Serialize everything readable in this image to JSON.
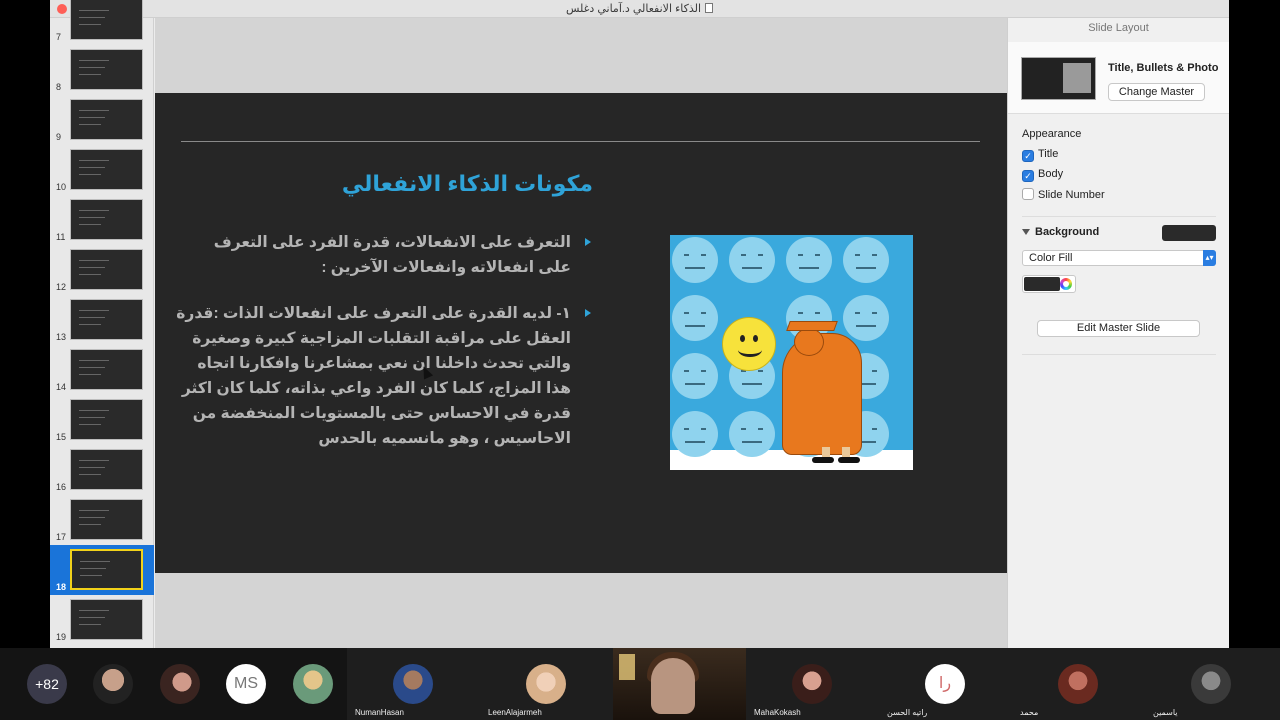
{
  "window": {
    "title": "الذكاء الانفعالي د.آماني دغلس"
  },
  "navigator": {
    "slides": [
      {
        "num": "7"
      },
      {
        "num": "8"
      },
      {
        "num": "9"
      },
      {
        "num": "10"
      },
      {
        "num": "11"
      },
      {
        "num": "12"
      },
      {
        "num": "13"
      },
      {
        "num": "14"
      },
      {
        "num": "15"
      },
      {
        "num": "16"
      },
      {
        "num": "17"
      },
      {
        "num": "18",
        "selected": true
      },
      {
        "num": "19"
      }
    ]
  },
  "slide": {
    "title": "مكونات الذكاء الانفعالي",
    "bullets": [
      "التعرف على الانفعالات، قدرة الفرد على التعرف على انفعالاته وانفعالات الآخرين :",
      "١- لديه القدرة على التعرف على انفعالات الذات :قدرة العقل على مراقبة التقلبات المزاجية كبيرة وصغيرة والتي تحدث داخلنا ان نعي بمشاعرنا وافكارنا اتجاه هذا المزاج، كلما كان الفرد واعي بذاته، كلما كان اكثر قدرة في الاحساس حتى بالمستويات المنخفضة من الاحاسيس ، وهو مانسميه بالحدس"
    ]
  },
  "inspector": {
    "header": "Slide Layout",
    "layout_name": "Title, Bullets & Photo",
    "change_master": "Change Master",
    "appearance_label": "Appearance",
    "checks": [
      {
        "label": "Title",
        "checked": true
      },
      {
        "label": "Body",
        "checked": true
      },
      {
        "label": "Slide Number",
        "checked": false
      }
    ],
    "background_label": "Background",
    "fill_type": "Color Fill",
    "edit_master": "Edit Master Slide"
  },
  "participants": {
    "more_count": "+82",
    "initials": [
      "MS",
      "را"
    ],
    "names": [
      "NumanHasan",
      "LeenAlajarmeh",
      "MahaKokash",
      "راتيه الحسن",
      "محمد",
      "ياسمين"
    ]
  },
  "colors": {
    "accent": "#2fa3d8",
    "selection": "#1a74d9",
    "slide_bg": "#262626"
  }
}
